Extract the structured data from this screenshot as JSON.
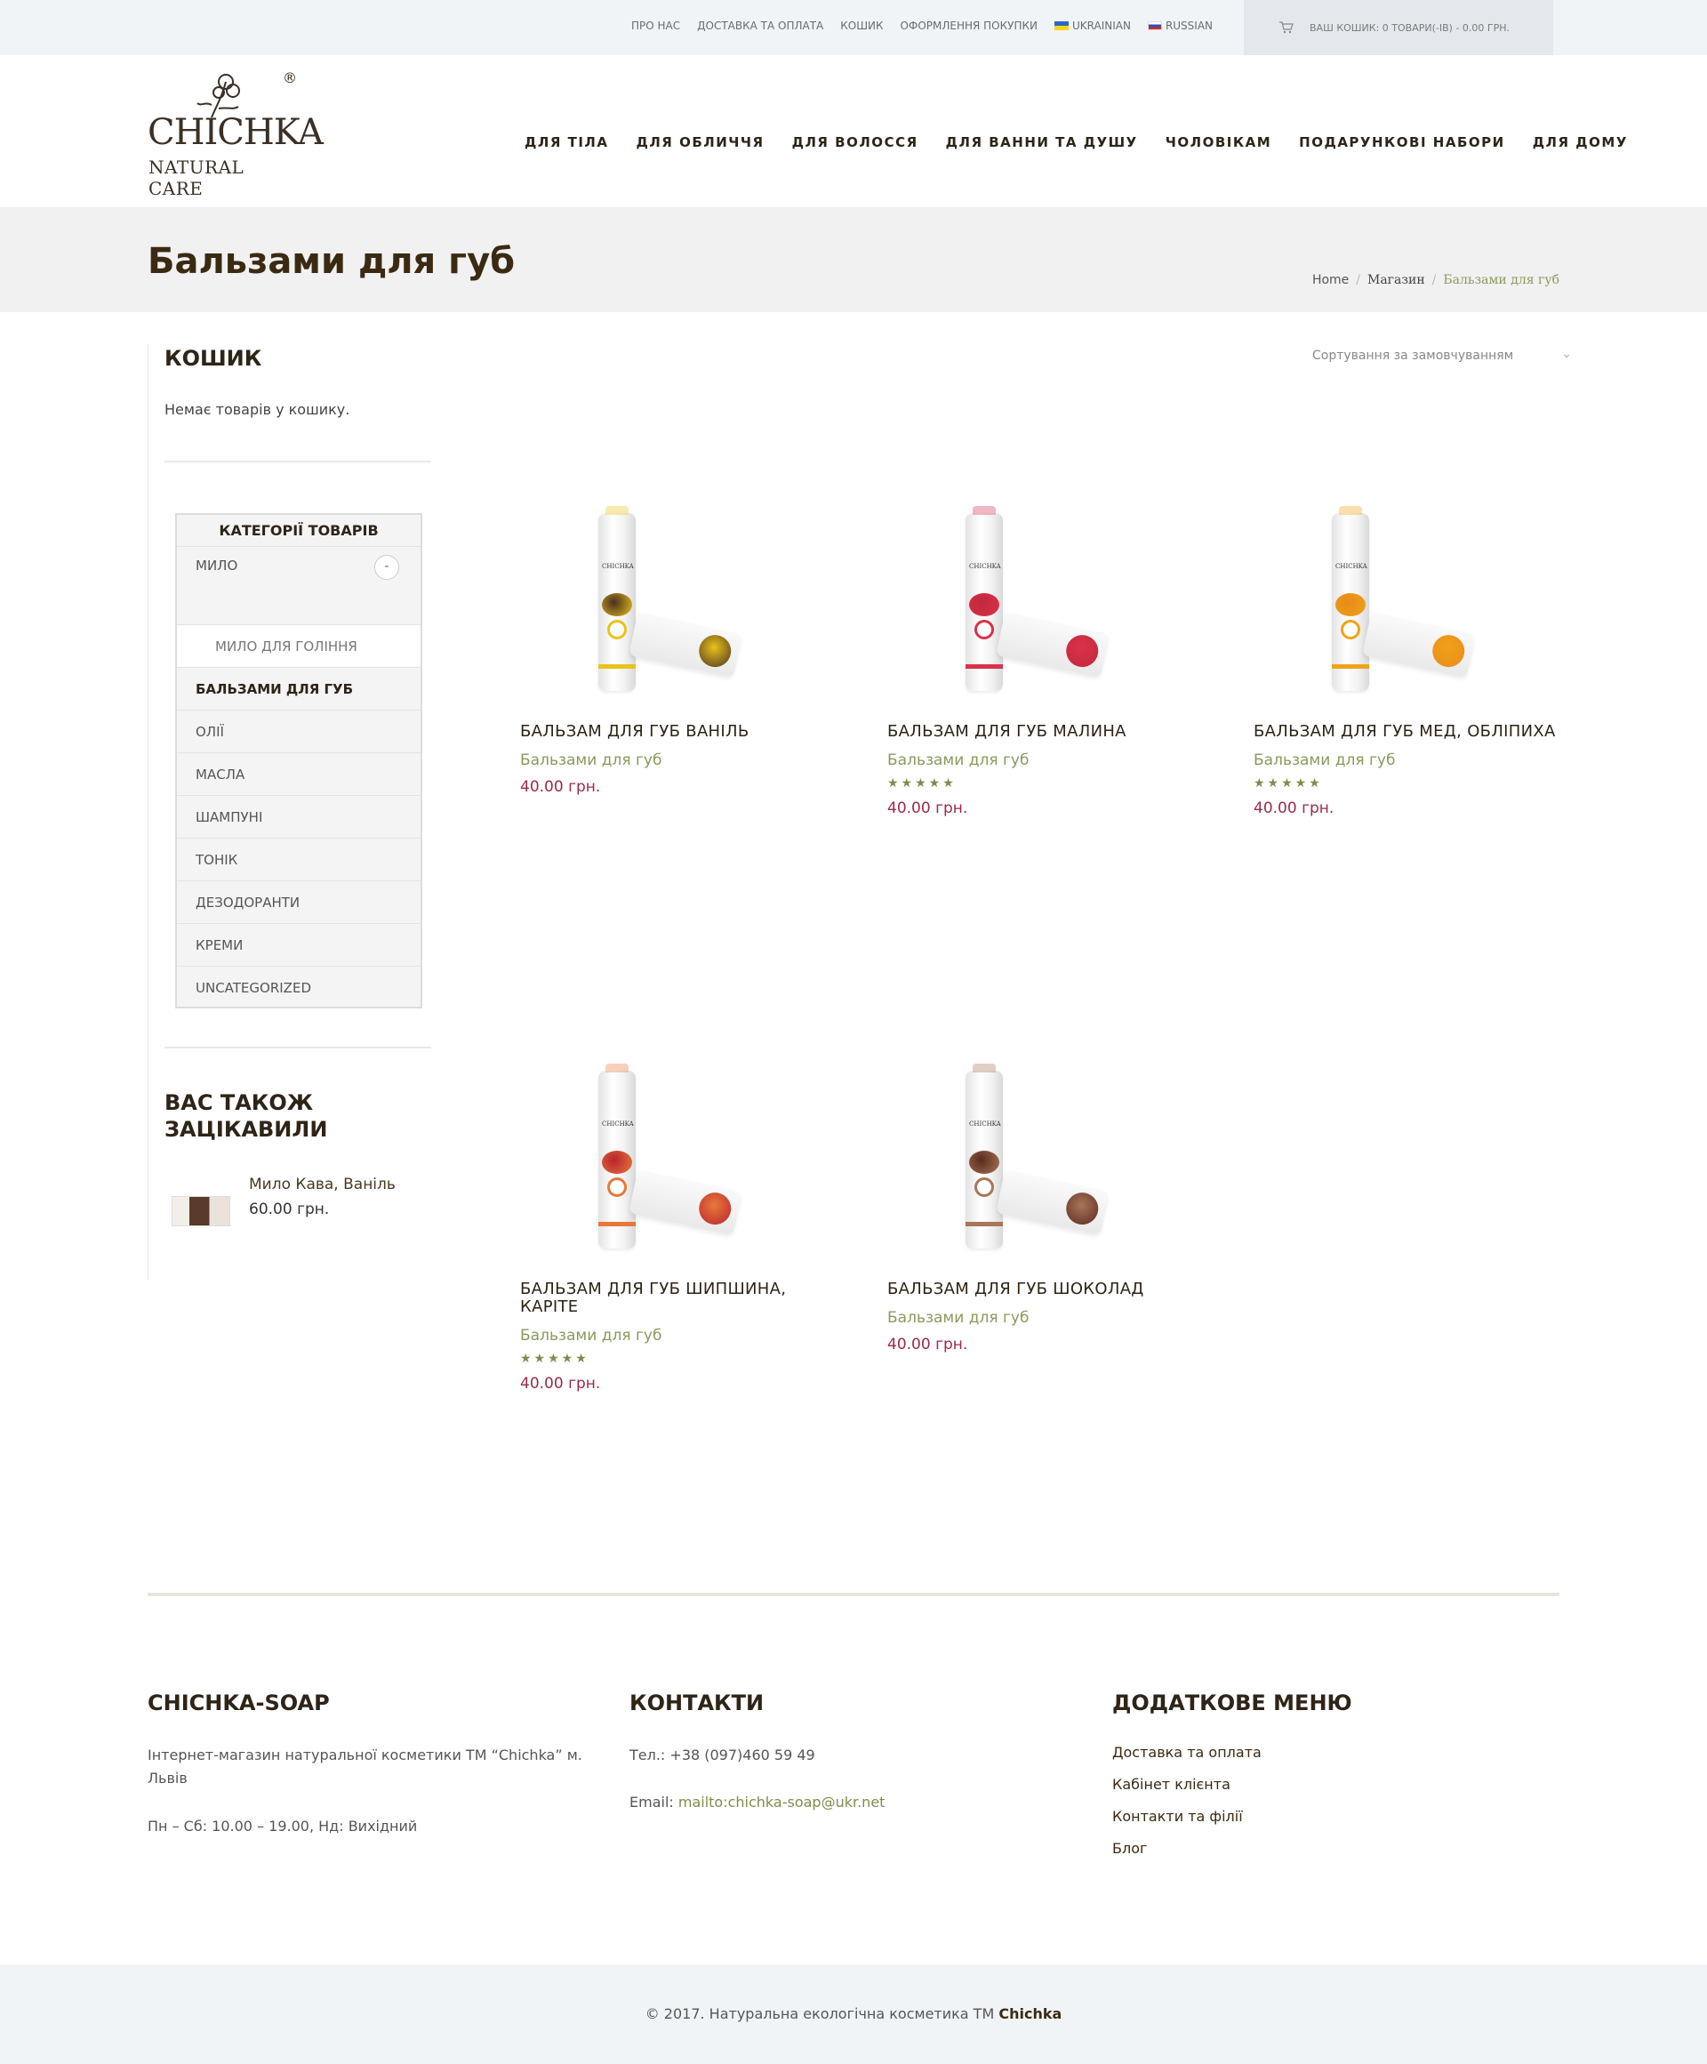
{
  "topbar": {
    "links": [
      "ПРО НАС",
      "ДОСТАВКА ТА ОПЛАТА",
      "КОШИК",
      "ОФОРМЛЕННЯ ПОКУПКИ"
    ],
    "lang_ua": "UKRAINIAN",
    "lang_ru": "RUSSIAN",
    "cart_text": "ВАШ КОШИК: 0 ТОВАРИ(-ІВ) - 0.00 ГРН."
  },
  "header": {
    "logo_name": "CHICHKA",
    "logo_sub": "NATURAL CARE",
    "logo_reg": "®",
    "nav": [
      "ДЛЯ ТІЛА",
      "ДЛЯ ОБЛИЧЧЯ",
      "ДЛЯ ВОЛОССЯ",
      "ДЛЯ ВАННИ ТА ДУШУ",
      "ЧОЛОВІКАМ",
      "ПОДАРУНКОВІ НАБОРИ",
      "ДЛЯ ДОМУ"
    ]
  },
  "title_band": {
    "title": "Бальзами для губ",
    "breadcrumb": [
      "Home",
      "Магазин",
      "Бальзами для губ"
    ]
  },
  "sidebar": {
    "cart_title": "КОШИК",
    "cart_empty": "Немає товарів у кошику.",
    "categories_title": "КАТЕГОРІЇ ТОВАРІВ",
    "category_milo": "МИЛО",
    "toggle": "-",
    "subcategory": "МИЛО ДЛЯ ГОЛІННЯ",
    "categories": [
      "БАЛЬЗАМИ ДЛЯ ГУБ",
      "ОЛІЇ",
      "МАСЛА",
      "ШАМПУНІ",
      "ТОНІК",
      "ДЕЗОДОРАНТИ",
      "КРЕМИ",
      "UNCATEGORIZED"
    ],
    "related_title": "ВАС ТАКОЖ ЗАЦІКАВИЛИ",
    "related_name": "Мило Кава, Ваніль",
    "related_price": "60.00 грн."
  },
  "sort_label": "Сортування за замовчуванням",
  "products": [
    {
      "name": "БАЛЬЗАМ ДЛЯ ГУБ ВАНІЛЬ",
      "category": "Бальзами для губ",
      "rating": "",
      "price": "40.00 грн.",
      "color": "#e9c21a",
      "accent": "#4a3020"
    },
    {
      "name": "БАЛЬЗАМ ДЛЯ ГУБ МАЛИНА",
      "category": "Бальзами для губ",
      "rating": "★★★★★",
      "price": "40.00 грн.",
      "color": "#d9324a",
      "accent": "#c2283c"
    },
    {
      "name": "БАЛЬЗАМ ДЛЯ ГУБ МЕД, ОБЛІПИХА",
      "category": "Бальзами для губ",
      "rating": "★★★★★",
      "price": "40.00 грн.",
      "color": "#f0a21a",
      "accent": "#e88a1a"
    },
    {
      "name": "БАЛЬЗАМ ДЛЯ ГУБ ШИПШИНА, КАРІТЕ",
      "category": "Бальзами для губ",
      "rating": "★★★★★",
      "price": "40.00 грн.",
      "color": "#e8783a",
      "accent": "#b8242e"
    },
    {
      "name": "БАЛЬЗАМ ДЛЯ ГУБ ШОКОЛАД",
      "category": "Бальзами для губ",
      "rating": "",
      "price": "40.00 грн.",
      "color": "#a8765a",
      "accent": "#5a2a1e"
    }
  ],
  "footer": {
    "col1_title": "CHICHKA-SOAP",
    "col1_text": "Інтернет-магазин натуральної косметики ТМ “Chichka” м. Львів",
    "col1_hours": "Пн – Сб: 10.00 – 19.00, Нд: Вихідний",
    "col2_title": "КОНТАКТИ",
    "phone": "Тел.: +38 (097)460 59 49",
    "email_label": "Email: ",
    "email": "mailto:chichka-soap@ukr.net",
    "col3_title": "ДОДАТКОВЕ МЕНЮ",
    "menu": [
      "Доставка та оплата",
      "Кабінет клієнта",
      "Контакти та філії",
      "Блог"
    ],
    "copyright_prefix": "© 2017. Натуральна екологічна косметика ТМ ",
    "copyright_brand": "Chichka"
  },
  "colors": {
    "accent_green": "#8a9a5b",
    "price": "#9a2a4a",
    "text_dark": "#2e2417"
  }
}
